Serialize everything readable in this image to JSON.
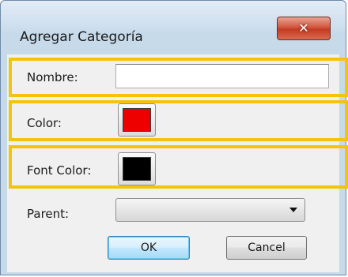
{
  "window": {
    "title": "Agregar Categoría",
    "close_glyph": "✕"
  },
  "form": {
    "nombre_label": "Nombre:",
    "nombre_value": "",
    "color_label": "Color:",
    "color_value": "#ee0000",
    "font_color_label": "Font Color:",
    "font_color_value": "#000000",
    "parent_label": "Parent:",
    "parent_value": ""
  },
  "buttons": {
    "ok": "OK",
    "cancel": "Cancel"
  },
  "highlight_color": "#f3c40f"
}
